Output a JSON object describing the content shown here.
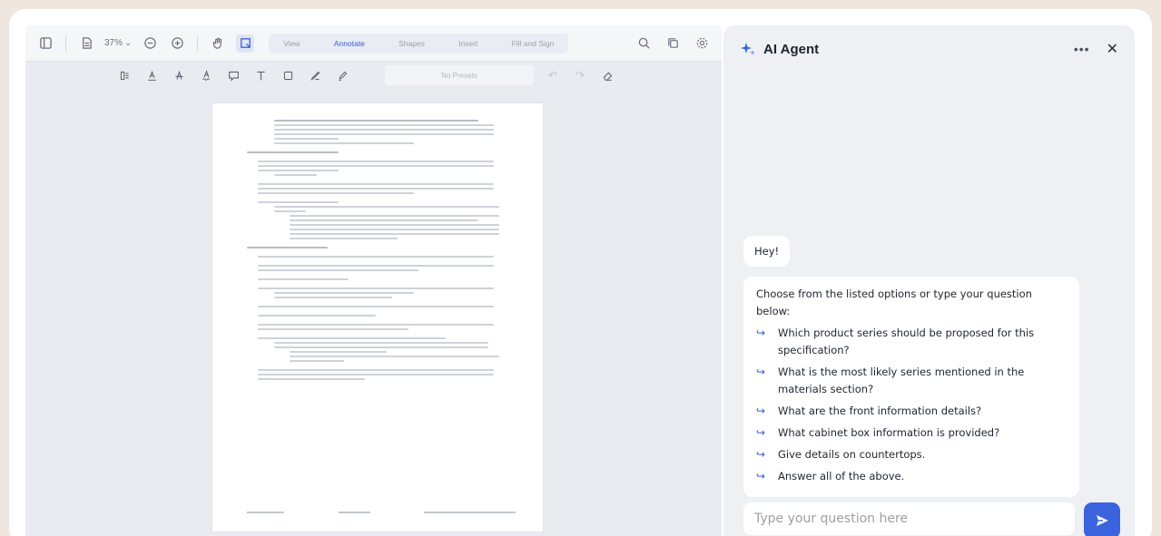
{
  "viewer": {
    "zoom": "37%",
    "tabs": [
      {
        "label": "View"
      },
      {
        "label": "Annotate"
      },
      {
        "label": "Shapes"
      },
      {
        "label": "Insert"
      },
      {
        "label": "Fill and Sign"
      }
    ],
    "active_tab": "Annotate",
    "preset_label": "No Presets",
    "icons": {
      "toolbar1": [
        "sidebar-toggle-icon",
        "file-icon",
        "zoom-out-icon",
        "zoom-in-icon",
        "pan-hand-icon",
        "select-icon",
        "search-icon",
        "copy-icon",
        "settings-icon"
      ],
      "toolbar2": [
        "highlight-icon",
        "underline-icon",
        "strikethrough-icon",
        "squiggly-icon",
        "comment-icon",
        "text-icon",
        "shape-icon",
        "pen-icon",
        "marker-icon",
        "undo-icon",
        "redo-icon",
        "eraser-icon"
      ]
    }
  },
  "agent": {
    "title": "AI Agent",
    "more_icon": "more-icon",
    "close_icon": "close-icon",
    "greeting": "Hey!",
    "intro": "Choose from the listed options or type your question below:",
    "options": [
      {
        "text": "Which product series should be proposed for this specification?"
      },
      {
        "text": "What is the most likely series mentioned in the materials section?"
      },
      {
        "text": "What are the front information details?"
      },
      {
        "text": "What cabinet box information is provided?"
      },
      {
        "text": "Give details on countertops."
      },
      {
        "text": "Answer all of the above."
      }
    ],
    "input_placeholder": "Type your question here",
    "send_icon": "send-icon",
    "accent_color": "#3b63e0"
  }
}
